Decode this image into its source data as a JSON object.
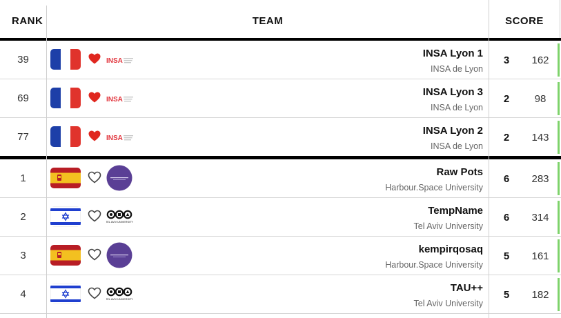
{
  "header": {
    "rank_label": "RANK",
    "team_label": "TEAM",
    "score_label": "SCORE"
  },
  "colors": {
    "heart_filled": "#e0271f",
    "heart_outline": "#444444",
    "progress_green": "#7ed36b",
    "flag_france_blue": "#1d3fa8",
    "flag_france_red": "#e0332c",
    "flag_spain_red": "#b81d25",
    "flag_spain_yellow": "#f3c020",
    "flag_israel_blue": "#1f3fcf",
    "harbour_space_purple": "#5a3f95",
    "insa_red": "#e1333b"
  },
  "logos": {
    "insa_text": "INSA",
    "tau_text": "TEL AVIV UNIVERSITY"
  },
  "rows": [
    {
      "rank": "39",
      "flag": "france",
      "favorite": true,
      "logo": "insa",
      "team": "INSA Lyon 1",
      "university": "INSA de Lyon",
      "solved": "3",
      "penalty": "162"
    },
    {
      "rank": "69",
      "flag": "france",
      "favorite": true,
      "logo": "insa",
      "team": "INSA Lyon 3",
      "university": "INSA de Lyon",
      "solved": "2",
      "penalty": "98"
    },
    {
      "rank": "77",
      "flag": "france",
      "favorite": true,
      "logo": "insa",
      "team": "INSA Lyon 2",
      "university": "INSA de Lyon",
      "solved": "2",
      "penalty": "143"
    },
    {
      "rank": "1",
      "flag": "spain",
      "favorite": false,
      "logo": "harbour",
      "team": "Raw Pots",
      "university": "Harbour.Space University",
      "solved": "6",
      "penalty": "283"
    },
    {
      "rank": "2",
      "flag": "israel",
      "favorite": false,
      "logo": "tau",
      "team": "TempName",
      "university": "Tel Aviv University",
      "solved": "6",
      "penalty": "314"
    },
    {
      "rank": "3",
      "flag": "spain",
      "favorite": false,
      "logo": "harbour",
      "team": "kempirqosaq",
      "university": "Harbour.Space University",
      "solved": "5",
      "penalty": "161"
    },
    {
      "rank": "4",
      "flag": "israel",
      "favorite": false,
      "logo": "tau",
      "team": "TAU++",
      "university": "Tel Aviv University",
      "solved": "5",
      "penalty": "182"
    }
  ]
}
